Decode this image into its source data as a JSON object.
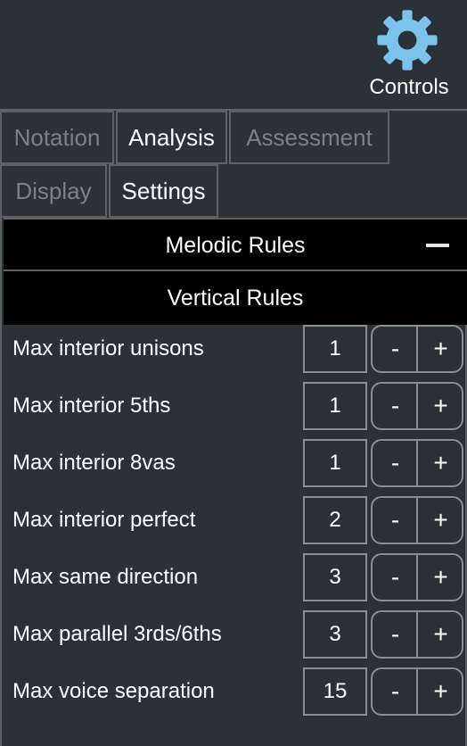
{
  "controls": {
    "label": "Controls",
    "icon": "gear-icon",
    "icon_color": "#7cc3ec"
  },
  "tabs_primary": [
    {
      "label": "Notation",
      "active": false
    },
    {
      "label": "Analysis",
      "active": true
    },
    {
      "label": "Assessment",
      "active": false
    }
  ],
  "tabs_secondary": [
    {
      "label": "Display",
      "active": false
    },
    {
      "label": "Settings",
      "active": true
    }
  ],
  "sections": {
    "melodic": {
      "title": "Melodic Rules",
      "toggle_icon": "minus-icon"
    },
    "vertical": {
      "title": "Vertical Rules"
    }
  },
  "rules": [
    {
      "label": "Max interior unisons",
      "value": "1"
    },
    {
      "label": "Max interior 5ths",
      "value": "1"
    },
    {
      "label": "Max interior 8vas",
      "value": "1"
    },
    {
      "label": "Max interior perfect",
      "value": "2"
    },
    {
      "label": "Max same direction",
      "value": "3"
    },
    {
      "label": "Max parallel 3rds/6ths",
      "value": "3"
    },
    {
      "label": "Max voice separation",
      "value": "15"
    }
  ],
  "stepper": {
    "minus_label": "-",
    "plus_label": "+"
  }
}
